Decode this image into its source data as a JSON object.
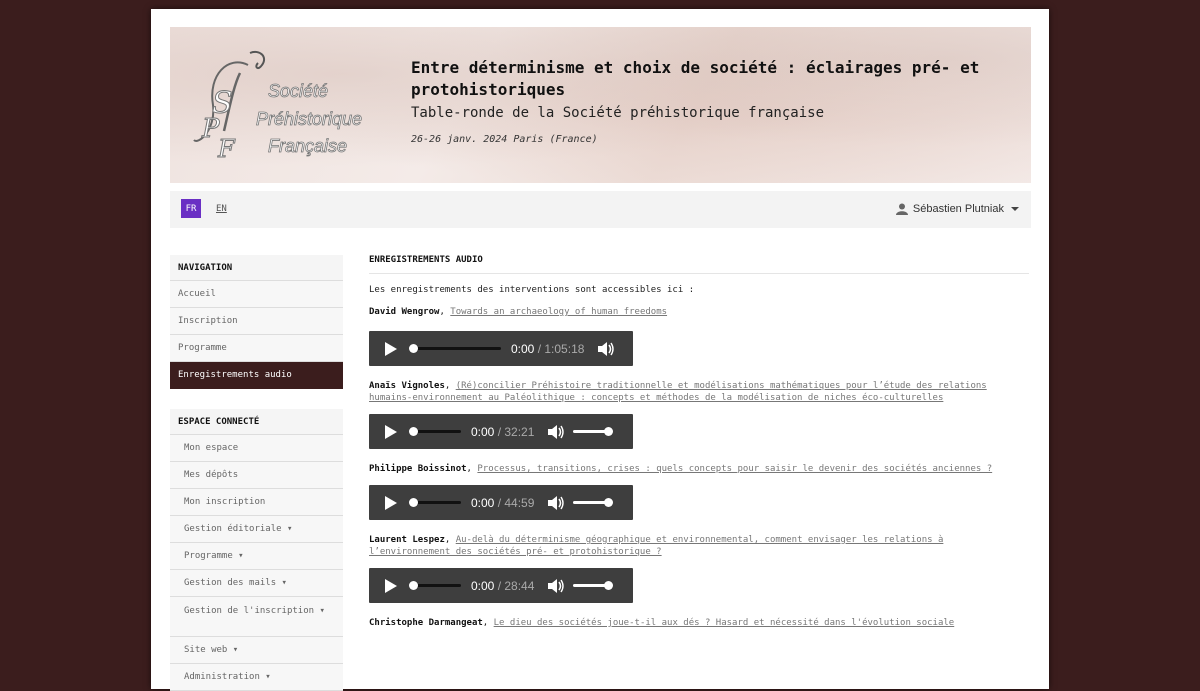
{
  "banner": {
    "logo_text": "Société Préhistorique Française",
    "title": "Entre déterminisme et choix de société : éclairages pré- et protohistoriques",
    "subtitle": "Table-ronde de la Société préhistorique française",
    "date": "26-26 janv. 2024 Paris (France)"
  },
  "toolbar": {
    "lang_fr": "FR",
    "lang_en": "EN",
    "user_name": "Sébastien Plutniak",
    "accent_color": "#6a2fc4"
  },
  "sidebar": {
    "navigation_header": "NAVIGATION",
    "navigation_items": [
      {
        "label": "Accueil"
      },
      {
        "label": "Inscription"
      },
      {
        "label": "Programme"
      },
      {
        "label": "Enregistrements audio"
      }
    ],
    "connected_header": "ESPACE CONNECTÉ",
    "connected_items": [
      {
        "label": "Mon espace"
      },
      {
        "label": "Mes dépôts"
      },
      {
        "label": "Mon inscription"
      },
      {
        "label": "Gestion éditoriale ▾"
      },
      {
        "label": "Programme ▾"
      },
      {
        "label": "Gestion des mails ▾"
      },
      {
        "label": "Gestion de l'inscription ▾"
      },
      {
        "label": "Site web ▾"
      },
      {
        "label": "Administration ▾"
      }
    ]
  },
  "main": {
    "section_title": "ENREGISTREMENTS AUDIO",
    "intro": "Les enregistrements des interventions sont accessibles ici :",
    "entries": [
      {
        "speaker": "David Wengrow",
        "title": "Towards an archaeology of human freedoms",
        "current": "0:00",
        "duration": "1:05:18"
      },
      {
        "speaker": "Anaïs Vignoles",
        "title": "(Ré)concilier Préhistoire traditionnelle et modélisations mathématiques pour l’étude des relations humains-environnement au Paléolithique : concepts et méthodes de la modélisation de niches éco-culturelles",
        "current": "0:00",
        "duration": "32:21"
      },
      {
        "speaker": "Philippe Boissinot",
        "title": "Processus, transitions, crises : quels concepts pour saisir le devenir des sociétés anciennes ?",
        "current": "0:00",
        "duration": "44:59"
      },
      {
        "speaker": "Laurent Lespez",
        "title": "Au-delà du déterminisme géographique et environnemental, comment envisager les relations à l’environnement des sociétés pré- et protohistorique ?",
        "current": "0:00",
        "duration": "28:44"
      },
      {
        "speaker": "Christophe Darmangeat",
        "title": "Le dieu des sociétés joue-t-il aux dés ? Hasard et nécessité dans l'évolution sociale"
      }
    ],
    "separator": ", ",
    "slash": " / "
  }
}
